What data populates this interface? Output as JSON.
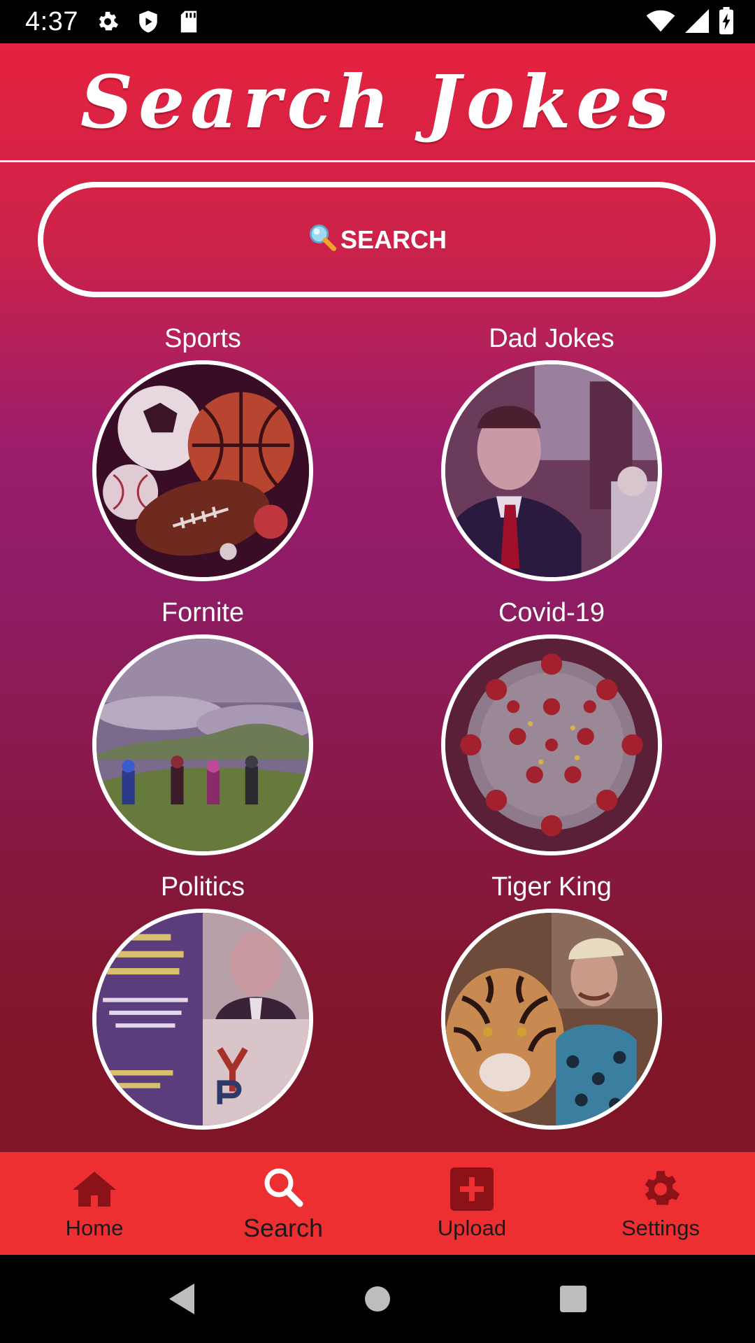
{
  "status_bar": {
    "time": "4:37"
  },
  "header": {
    "title": "Search Jokes"
  },
  "search_button": {
    "label": "SEARCH",
    "icon": "magnifier-emoji"
  },
  "categories": [
    {
      "label": "Sports"
    },
    {
      "label": "Dad Jokes"
    },
    {
      "label": "Fornite"
    },
    {
      "label": "Covid-19"
    },
    {
      "label": "Politics"
    },
    {
      "label": "Tiger King"
    }
  ],
  "bottom_nav": {
    "active": "Search",
    "items": [
      {
        "label": "Home",
        "icon": "home-icon"
      },
      {
        "label": "Search",
        "icon": "search-icon"
      },
      {
        "label": "Upload",
        "icon": "plus-square-icon"
      },
      {
        "label": "Settings",
        "icon": "gear-icon"
      }
    ]
  },
  "colors": {
    "header_red": "#e5223f",
    "bottom_nav": "#ee2f31",
    "active_icon": "#ffffff",
    "inactive_icon": "#8b1216"
  }
}
